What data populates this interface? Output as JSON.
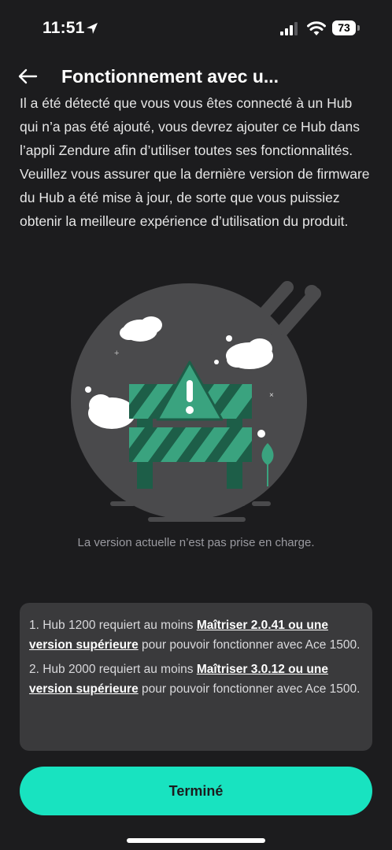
{
  "status_bar": {
    "time": "11:51",
    "battery": "73"
  },
  "header": {
    "title": "Fonctionnement avec u..."
  },
  "intro": "Il a été détecté que vous vous êtes connecté à un Hub qui n’a pas été ajouté, vous devrez ajouter ce Hub dans l’appli Zendure afin d’utiliser toutes ses fonctionnalités. Veuillez vous assurer que la dernière version de firmware du Hub a été mise à jour, de sorte que vous puissiez obtenir la meilleure expérience d’utilisation du produit.",
  "illustration": {
    "icon": "barrier-warning-icon",
    "accent": "#3aa37f"
  },
  "caption": "La version actuelle n’est pas prise en charge.",
  "requirements": [
    {
      "prefix": "1. Hub 1200 requiert au moins ",
      "link": "Maîtriser 2.0.41 ou une version supérieure",
      "suffix": " pour pouvoir fonctionner avec Ace 1500."
    },
    {
      "prefix": "2. Hub 2000 requiert au moins ",
      "link": "Maîtriser 3.0.12 ou une version supérieure",
      "suffix": " pour pouvoir fonctionner avec Ace 1500."
    }
  ],
  "done_button": "Terminé",
  "colors": {
    "background": "#1c1c1e",
    "accent": "#18e3c0",
    "card": "#3a3a3c"
  }
}
